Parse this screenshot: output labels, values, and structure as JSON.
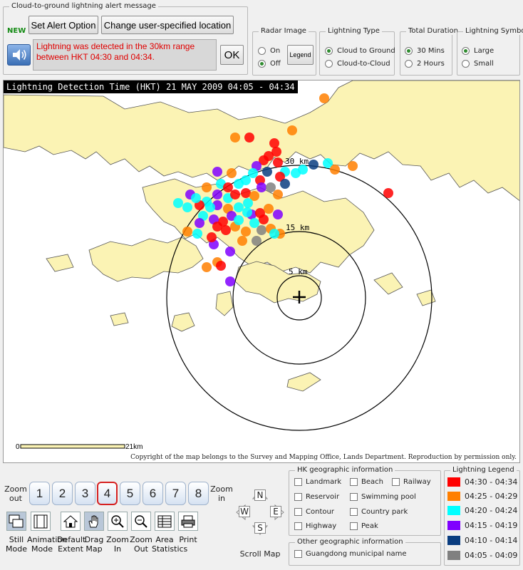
{
  "alert": {
    "group_title": "Cloud-to-ground lightning alert message",
    "new_badge": "NEW",
    "set_alert_label": "Set Alert Option",
    "change_location_label": "Change user-specified location",
    "message": "Lightning was detected in the 30km range between HKT 04:30 and 04:34.",
    "ok_label": "OK"
  },
  "radar": {
    "title": "Radar Image",
    "on": "On",
    "off": "Off",
    "legend_button": "Legend",
    "selected": "Off"
  },
  "lightning_type": {
    "title": "Lightning Type",
    "options": [
      "Cloud to Ground",
      "Cloud-to-Cloud"
    ],
    "selected": "Cloud to Ground"
  },
  "total_duration": {
    "title": "Total Duration",
    "options": [
      "30 Mins",
      "2 Hours"
    ],
    "selected": "30 Mins"
  },
  "lightning_symbol": {
    "title": "Lightning Symbol",
    "options": [
      "Large",
      "Small"
    ],
    "selected": "Large"
  },
  "map": {
    "header": "Lightning Detection Time (HKT) 21 MAY 2009 04:05 - 04:34",
    "ring_labels": [
      "30 km",
      "15 km",
      "5 km"
    ],
    "scale_start": "0",
    "scale_end": "21km",
    "copyright": "Copyright of the map belongs to the Survey and Mapping Office, Lands Department. Reproduction by permission only."
  },
  "zoom": {
    "out_label": "Zoom out",
    "in_label": "Zoom in",
    "levels": [
      "1",
      "2",
      "3",
      "4",
      "5",
      "6",
      "7",
      "8"
    ],
    "active": "4"
  },
  "tools": [
    {
      "label": "Still Mode",
      "icon": "still-mode-icon"
    },
    {
      "label": "Animation Mode",
      "icon": "animation-mode-icon"
    },
    {
      "label": "Default Extent",
      "icon": "home-icon"
    },
    {
      "label": "Drag Map",
      "icon": "hand-icon"
    },
    {
      "label": "Zoom In",
      "icon": "zoom-in-icon"
    },
    {
      "label": "Zoom Out",
      "icon": "zoom-out-icon"
    },
    {
      "label": "Area Statistics",
      "icon": "table-icon"
    },
    {
      "label": "Print",
      "icon": "printer-icon"
    }
  ],
  "scroll_map": {
    "label": "Scroll Map",
    "n": "N",
    "s": "S",
    "e": "E",
    "w": "W"
  },
  "geo_info": {
    "title": "HK geographic information",
    "items": [
      "Landmark",
      "Beach",
      "Railway",
      "Reservoir",
      "Swimming pool",
      "Contour",
      "Country park",
      "Highway",
      "Peak"
    ]
  },
  "other_geo": {
    "title": "Other geographic information",
    "items": [
      "Guangdong municipal name"
    ]
  },
  "legend": {
    "title": "Lightning Legend",
    "entries": [
      {
        "label": "04:30 - 04:34",
        "color": "#ff0000"
      },
      {
        "label": "04:25 - 04:29",
        "color": "#ff7f00"
      },
      {
        "label": "04:20 - 04:24",
        "color": "#00ffff"
      },
      {
        "label": "04:15 - 04:19",
        "color": "#8000ff"
      },
      {
        "label": "04:10 - 04:14",
        "color": "#0a3d80"
      },
      {
        "label": "04:05 - 04:09",
        "color": "#808080"
      }
    ]
  }
}
